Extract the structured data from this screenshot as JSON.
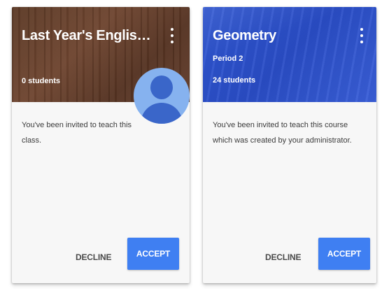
{
  "colors": {
    "accent": "#3f7ff2",
    "banner_wood": "#5c3a26",
    "banner_blue": "#2f56d2",
    "avatar_light": "#86b2ef",
    "avatar_dark": "#3a66c9"
  },
  "cards": [
    {
      "title": "Last Year's English Class",
      "subtitle": "",
      "students": "0 students",
      "description": "You've been invited to teach this class.",
      "menu_icon": "more-vert-icon",
      "avatar_icon": "person-avatar-icon",
      "decline_label": "DECLINE",
      "accept_label": "ACCEPT"
    },
    {
      "title": "Geometry",
      "subtitle": "Period 2",
      "students": "24 students",
      "description": "You've been invited to teach this course which was created by your administrator.",
      "menu_icon": "more-vert-icon",
      "decline_label": "DECLINE",
      "accept_label": "ACCEPT"
    }
  ]
}
